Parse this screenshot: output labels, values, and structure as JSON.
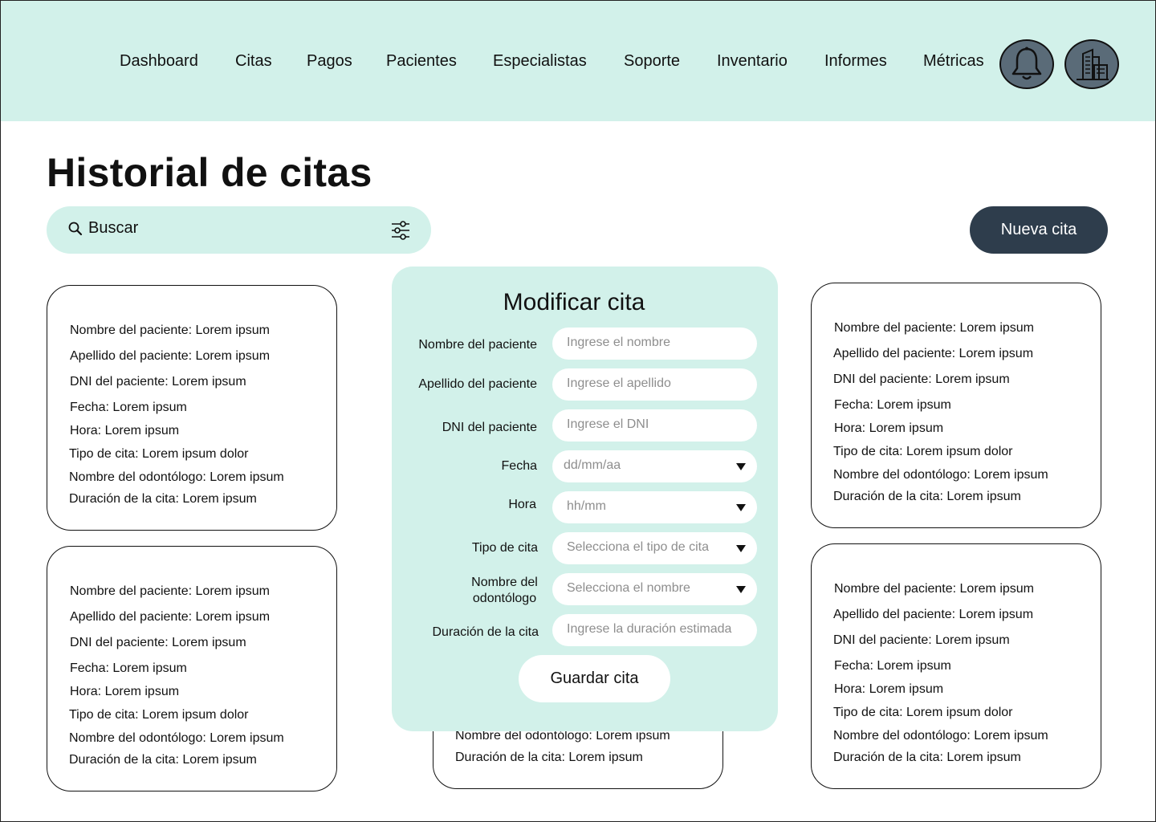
{
  "nav": {
    "items": [
      "Dashboard",
      "Citas",
      "Pagos",
      "Pacientes",
      "Especialistas",
      "Soporte",
      "Inventario",
      "Informes",
      "Métricas"
    ],
    "bell_icon": "bell-icon",
    "building_icon": "building-icon"
  },
  "page": {
    "title": "Historial de citas"
  },
  "search": {
    "placeholder": "Buscar",
    "icon": "search-icon",
    "filter_icon": "sliders-icon"
  },
  "actions": {
    "new_appointment": "Nueva cita"
  },
  "cards": [
    {
      "lines": [
        "Nombre del paciente: Lorem ipsum",
        "Apellido del paciente: Lorem ipsum",
        "DNI del paciente: Lorem ipsum",
        "Fecha: Lorem ipsum",
        "Hora: Lorem ipsum",
        "Tipo de cita: Lorem ipsum dolor",
        "Nombre del odontólogo: Lorem ipsum",
        "Duración de la cita: Lorem ipsum"
      ]
    },
    {
      "lines": [
        "Nombre del paciente: Lorem ipsum",
        "Apellido del paciente: Lorem ipsum",
        "DNI del paciente: Lorem ipsum",
        "Fecha: Lorem ipsum",
        "Hora: Lorem ipsum",
        "Tipo de cita: Lorem ipsum dolor",
        "Nombre del odontólogo: Lorem ipsum",
        "Duración de la cita: Lorem ipsum"
      ]
    },
    {
      "lines": [
        "Nombre del paciente: Lorem ipsum",
        "Apellido del paciente: Lorem ipsum",
        "DNI del paciente: Lorem ipsum",
        "Fecha: Lorem ipsum",
        "Hora: Lorem ipsum",
        "Tipo de cita: Lorem ipsum dolor",
        "Nombre del odontólogo: Lorem ipsum",
        "Duración de la cita: Lorem ipsum"
      ]
    },
    {
      "lines": [
        "Nombre del paciente: Lorem ipsum",
        "Apellido del paciente: Lorem ipsum",
        "DNI del paciente: Lorem ipsum",
        "Fecha: Lorem ipsum",
        "Hora: Lorem ipsum",
        "Tipo de cita: Lorem ipsum dolor",
        "Nombre del odontólogo: Lorem ipsum",
        "Duración de la cita: Lorem ipsum"
      ]
    },
    {
      "lines": [
        "Nombre del odontólogo: Lorem ipsum",
        "Duración de la cita: Lorem ipsum"
      ]
    }
  ],
  "modal": {
    "title": "Modificar cita",
    "fields": [
      {
        "label": "Nombre del paciente",
        "placeholder": "Ingrese el nombre",
        "dropdown": false
      },
      {
        "label": "Apellido del paciente",
        "placeholder": "Ingrese el apellido",
        "dropdown": false
      },
      {
        "label": "DNI del paciente",
        "placeholder": "Ingrese el DNI",
        "dropdown": false
      },
      {
        "label": "Fecha",
        "placeholder": "dd/mm/aa",
        "dropdown": true
      },
      {
        "label": "Hora",
        "placeholder": "hh/mm",
        "dropdown": true
      },
      {
        "label": "Tipo de cita",
        "placeholder": "Selecciona el tipo de cita",
        "dropdown": true
      },
      {
        "label_line1": "Nombre del",
        "label_line2": "odontólogo",
        "placeholder": "Selecciona el nombre",
        "dropdown": true
      },
      {
        "label": "Duración de la cita",
        "placeholder": "Ingrese la duración estimada",
        "dropdown": false
      }
    ],
    "save_label": "Guardar cita"
  },
  "colors": {
    "accent_light": "#d2f1ea",
    "button_dark": "#2e3d4c",
    "icon_circle": "#5a6b78"
  }
}
